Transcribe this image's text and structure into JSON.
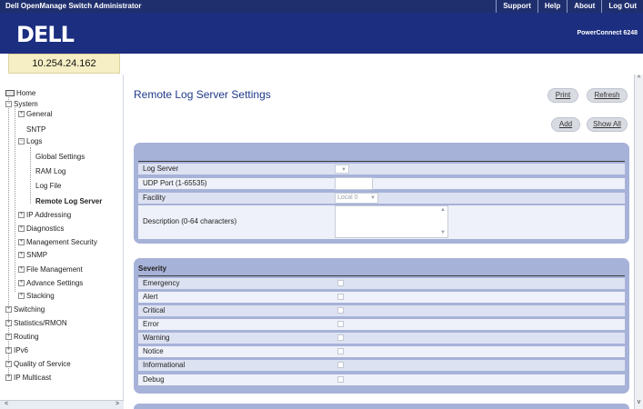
{
  "app_title": "Dell OpenManage Switch Administrator",
  "top_links": {
    "support": "Support",
    "help": "Help",
    "about": "About",
    "logout": "Log Out"
  },
  "brand": {
    "logo": "DELL",
    "product": "PowerConnect 6248"
  },
  "device_ip": "10.254.24.162",
  "nav": {
    "home": "Home",
    "system": "System",
    "general": "General",
    "sntp": "SNTP",
    "logs": "Logs",
    "global_settings": "Global Settings",
    "ram_log": "RAM Log",
    "log_file": "Log File",
    "remote_log_server": "Remote Log Server",
    "ip_addressing": "IP Addressing",
    "diagnostics": "Diagnostics",
    "management_security": "Management Security",
    "snmp": "SNMP",
    "file_management": "File Management",
    "advance_settings": "Advance Settings",
    "stacking": "Stacking",
    "switching": "Switching",
    "statistics_rmon": "Statistics/RMON",
    "routing": "Routing",
    "ipv6": "IPv6",
    "quality_of_service": "Quality of Service",
    "ip_multicast": "IP Multicast"
  },
  "page_title": "Remote Log Server Settings",
  "buttons": {
    "print": "Print",
    "refresh": "Refresh",
    "add": "Add",
    "show_all": "Show All"
  },
  "form": {
    "log_server_label": "Log Server",
    "log_server_value": "",
    "udp_port_label": "UDP Port (1-65535)",
    "udp_port_value": "",
    "facility_label": "Facility",
    "facility_value": "Local 0",
    "description_label": "Description (0-64 characters)",
    "description_value": ""
  },
  "severity": {
    "heading": "Severity",
    "levels": [
      "Emergency",
      "Alert",
      "Critical",
      "Error",
      "Warning",
      "Notice",
      "Informational",
      "Debug"
    ]
  }
}
